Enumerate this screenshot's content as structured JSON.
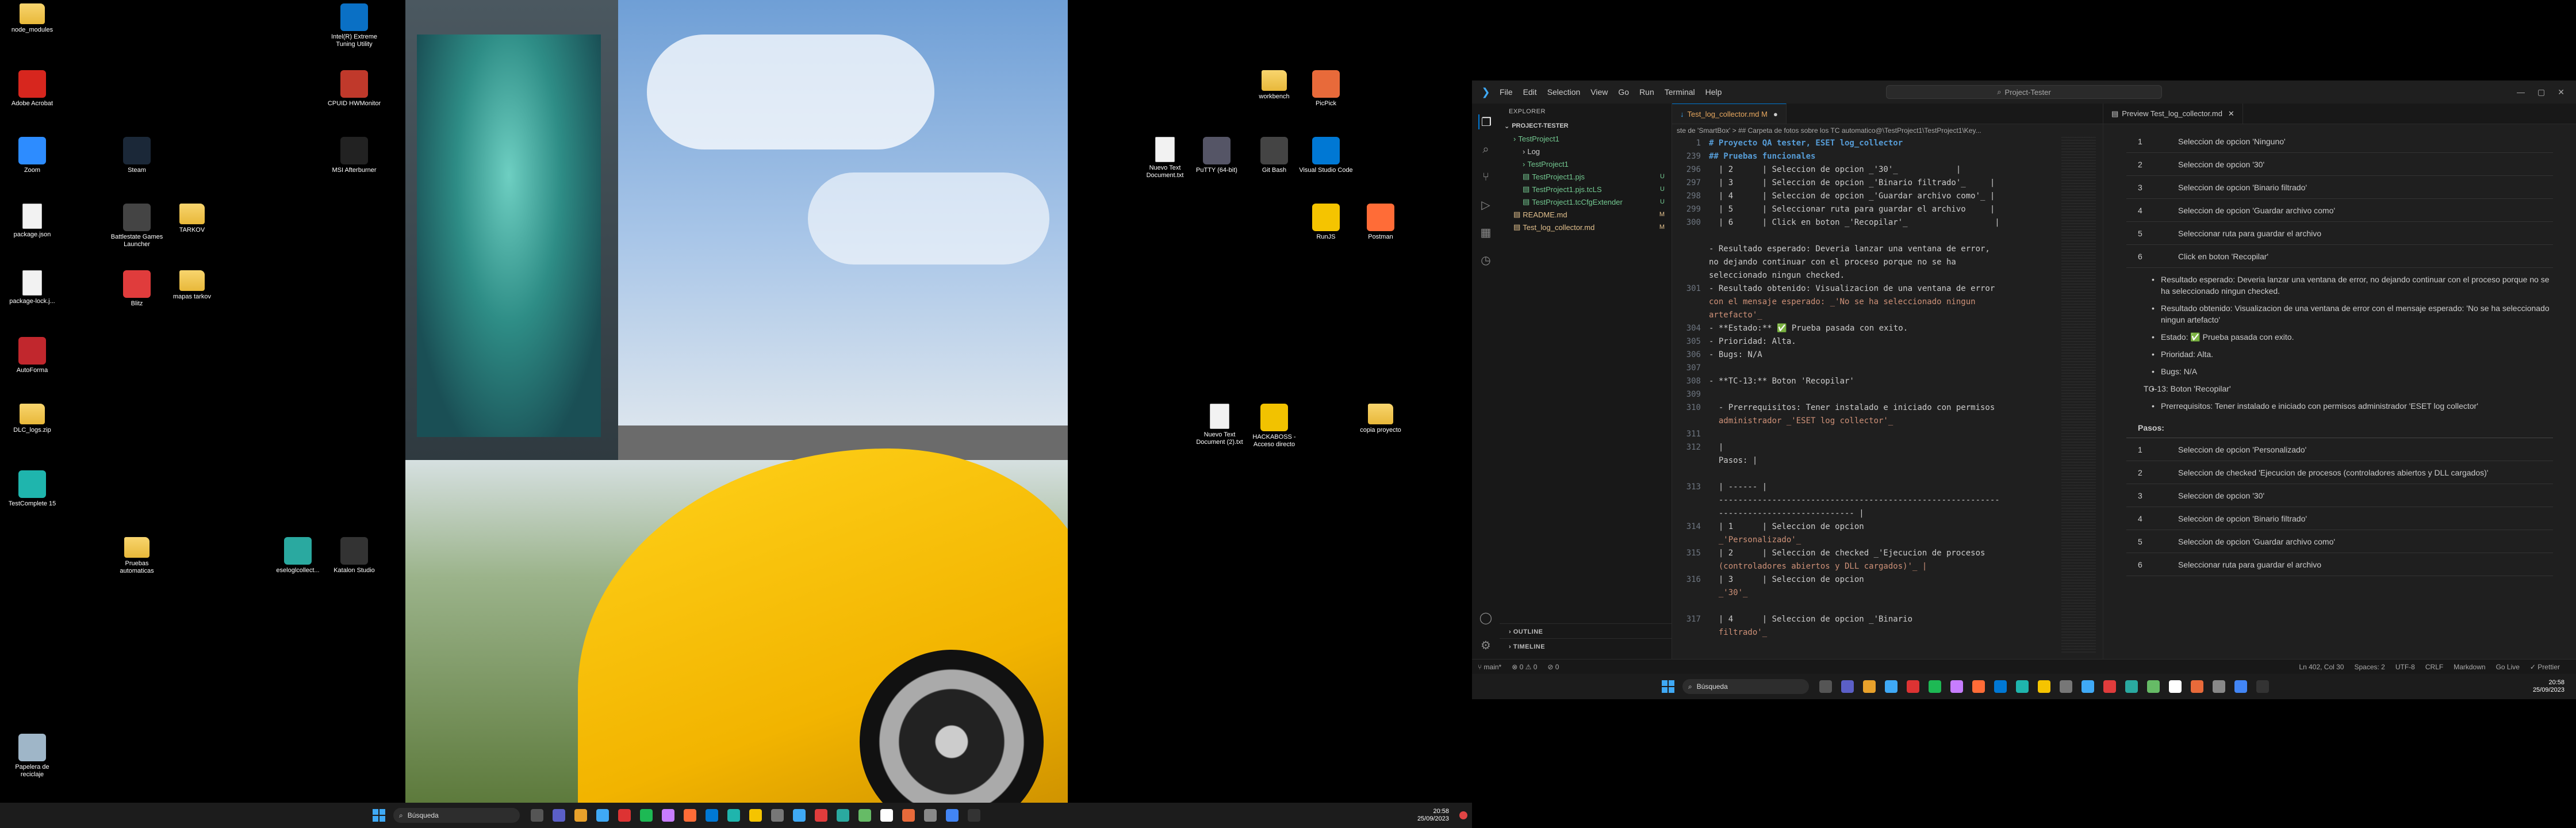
{
  "left_desktop": {
    "icons": [
      {
        "label": "node_modules",
        "icon": "folder-icon"
      },
      {
        "label": "Adobe Acrobat",
        "icon": "acrobat-icon"
      },
      {
        "label": "Zoom",
        "icon": "zoom-icon"
      },
      {
        "label": "package.json",
        "icon": "doc-icon"
      },
      {
        "label": "package-lock.j...",
        "icon": "doc-icon"
      },
      {
        "label": "AutoForma",
        "icon": "autoforma-icon"
      },
      {
        "label": "DLC_logs.zip",
        "icon": "zip-icon"
      },
      {
        "label": "TestComplete 15",
        "icon": "testcomplete-icon"
      },
      {
        "label": "Papelera de reciclaje",
        "icon": "recycle-bin-icon"
      },
      {
        "label": "Steam",
        "icon": "steam-icon"
      },
      {
        "label": "Battlestate Games Launcher",
        "icon": "bsg-icon"
      },
      {
        "label": "Blitz",
        "icon": "blitz-icon"
      },
      {
        "label": "Pruebas automaticas",
        "icon": "folder-icon"
      },
      {
        "label": "TARKOV",
        "icon": "folder-icon"
      },
      {
        "label": "mapas tarkov",
        "icon": "folder-icon"
      },
      {
        "label": "eseloglcollect...",
        "icon": "eset-icon"
      },
      {
        "label": "Intel(R) Extreme Tuning Utility",
        "icon": "intel-icon"
      },
      {
        "label": "CPUID HWMonitor",
        "icon": "hwmonitor-icon"
      },
      {
        "label": "MSI Afterburner",
        "icon": "msi-icon"
      },
      {
        "label": "Katalon Studio",
        "icon": "katalon-icon"
      }
    ],
    "right_icons": [
      {
        "label": "workbench",
        "icon": "folder-icon"
      },
      {
        "label": "PicPick",
        "icon": "picpick-icon"
      },
      {
        "label": "Nuevo Text Document.txt",
        "icon": "doc-icon"
      },
      {
        "label": "PuTTY (64-bit)",
        "icon": "putty-icon"
      },
      {
        "label": "Git Bash",
        "icon": "gitbash-icon"
      },
      {
        "label": "Visual Studio Code",
        "icon": "vscode-icon"
      },
      {
        "label": "RunJS",
        "icon": "runjs-icon"
      },
      {
        "label": "Postman",
        "icon": "postman-icon"
      },
      {
        "label": "Nuevo Text Document (2).txt",
        "icon": "doc-icon"
      },
      {
        "label": "HACKABOSS - Acceso directo",
        "icon": "warning-icon"
      },
      {
        "label": "copia proyecto",
        "icon": "folder-icon"
      }
    ]
  },
  "taskbar_left": {
    "search": "Búsqueda",
    "time": "20:58",
    "date": "25/09/2023"
  },
  "taskbar_right": {
    "search": "Búsqueda",
    "time": "20:58",
    "date": "25/09/2023"
  },
  "vscode": {
    "menu": [
      "File",
      "Edit",
      "Selection",
      "View",
      "Go",
      "Run",
      "Terminal",
      "Help"
    ],
    "command_center": "Project-Tester",
    "explorer_title": "EXPLORER",
    "project_title": "PROJECT-TESTER",
    "tree": [
      {
        "label": "TestProject1",
        "indent": 1,
        "badge": "",
        "color": "#73c991"
      },
      {
        "label": "Log",
        "indent": 2,
        "badge": "",
        "color": "#ccc"
      },
      {
        "label": "TestProject1",
        "indent": 2,
        "badge": "",
        "color": "#73c991"
      },
      {
        "label": "TestProject1.pjs",
        "indent": 2,
        "badge": "U",
        "color": "#73c991"
      },
      {
        "label": "TestProject1.pjs.tcLS",
        "indent": 2,
        "badge": "U",
        "color": "#73c991"
      },
      {
        "label": "TestProject1.tcCfgExtender",
        "indent": 2,
        "badge": "U",
        "color": "#73c991"
      },
      {
        "label": "README.md",
        "indent": 1,
        "badge": "M",
        "color": "#e2c08d"
      },
      {
        "label": "Test_log_collector.md",
        "indent": 1,
        "badge": "M",
        "color": "#e2c08d"
      }
    ],
    "outline": "OUTLINE",
    "timeline": "TIMELINE",
    "editor_tab": "Test_log_collector.md M",
    "preview_tab": "Preview Test_log_collector.md",
    "breadcrumb": "ste de 'SmartBox' > ## Carpeta de fotos sobre los TC automatico@\\TestProject1\\TestProject1\\Key...",
    "code_lines": [
      {
        "n": "1",
        "t": "# Proyecto QA tester, ESET log_collector",
        "c": "h1"
      },
      {
        "n": "239",
        "t": "## Pruebas funcionales",
        "c": "h1"
      },
      {
        "n": "296",
        "t": "  | 2      | Seleccion de opcion _'30'_            |",
        "c": ""
      },
      {
        "n": "297",
        "t": "  | 3      | Seleccion de opcion _'Binario filtrado'_     |",
        "c": ""
      },
      {
        "n": "298",
        "t": "  | 4      | Seleccion de opcion _'Guardar archivo como'_ |",
        "c": ""
      },
      {
        "n": "299",
        "t": "  | 5      | Seleccionar ruta para guardar el archivo     |",
        "c": ""
      },
      {
        "n": "300",
        "t": "  | 6      | Click en boton _'Recopilar'_                  |",
        "c": ""
      },
      {
        "n": "",
        "t": "",
        "c": ""
      },
      {
        "n": "",
        "t": "- Resultado esperado: Deveria lanzar una ventana de error,",
        "c": ""
      },
      {
        "n": "",
        "t": "no dejando continuar con el proceso porque no se ha",
        "c": ""
      },
      {
        "n": "",
        "t": "seleccionado ningun checked.",
        "c": ""
      },
      {
        "n": "301",
        "t": "- Resultado obtenido: Visualizacion de una ventana de error",
        "c": ""
      },
      {
        "n": "",
        "t": "con el mensaje esperado: _'No se ha seleccionado ningun",
        "c": "em"
      },
      {
        "n": "",
        "t": "artefacto'_",
        "c": "em"
      },
      {
        "n": "304",
        "t": "- **Estado:** ✅ Prueba pasada con exito.",
        "c": ""
      },
      {
        "n": "305",
        "t": "- Prioridad: Alta.",
        "c": ""
      },
      {
        "n": "306",
        "t": "- Bugs: N/A",
        "c": ""
      },
      {
        "n": "307",
        "t": "",
        "c": ""
      },
      {
        "n": "308",
        "t": "- **TC-13:** Boton 'Recopilar'",
        "c": ""
      },
      {
        "n": "309",
        "t": "",
        "c": ""
      },
      {
        "n": "310",
        "t": "  - Prerrequisitos: Tener instalado e iniciado con permisos",
        "c": ""
      },
      {
        "n": "",
        "t": "  administrador _'ESET log collector'_",
        "c": "em"
      },
      {
        "n": "311",
        "t": "",
        "c": ""
      },
      {
        "n": "312",
        "t": "  |",
        "c": ""
      },
      {
        "n": "",
        "t": "  Pasos: |",
        "c": ""
      },
      {
        "n": "",
        "t": "",
        "c": ""
      },
      {
        "n": "313",
        "t": "  | ------ |",
        "c": ""
      },
      {
        "n": "",
        "t": "  ----------------------------------------------------------",
        "c": ""
      },
      {
        "n": "",
        "t": "  ---------------------------- |",
        "c": ""
      },
      {
        "n": "314",
        "t": "  | 1      | Seleccion de opcion",
        "c": ""
      },
      {
        "n": "",
        "t": "  _'Personalizado'_",
        "c": "em"
      },
      {
        "n": "315",
        "t": "  | 2      | Seleccion de checked _'Ejecucion de procesos",
        "c": ""
      },
      {
        "n": "",
        "t": "  (controladores abiertos y DLL cargados)'_ |",
        "c": "em"
      },
      {
        "n": "316",
        "t": "  | 3      | Seleccion de opcion",
        "c": ""
      },
      {
        "n": "",
        "t": "  _'30'_",
        "c": "em"
      },
      {
        "n": "",
        "t": "",
        "c": ""
      },
      {
        "n": "317",
        "t": "  | 4      | Seleccion de opcion _'Binario",
        "c": ""
      },
      {
        "n": "",
        "t": "  filtrado'_",
        "c": "em"
      }
    ],
    "preview": {
      "rows_top": [
        {
          "n": "1",
          "t": "Seleccion de opcion 'Ninguno'"
        },
        {
          "n": "2",
          "t": "Seleccion de opcion '30'"
        },
        {
          "n": "3",
          "t": "Seleccion de opcion 'Binario filtrado'"
        },
        {
          "n": "4",
          "t": "Seleccion de opcion 'Guardar archivo como'"
        },
        {
          "n": "5",
          "t": "Seleccionar ruta para guardar el archivo"
        },
        {
          "n": "6",
          "t": "Click en boton 'Recopilar'"
        }
      ],
      "bullets": [
        "Resultado esperado: Deveria lanzar una ventana de error, no dejando continuar con el proceso porque no se ha seleccionado ningun checked.",
        "Resultado obtenido: Visualizacion de una ventana de error con el mensaje esperado: 'No se ha seleccionado ningun artefacto'",
        "Estado: ✅ Prueba pasada con exito.",
        "Prioridad: Alta.",
        "Bugs: N/A"
      ],
      "tc13": "TC-13: Boton 'Recopilar'",
      "prereq": "Prerrequisitos: Tener instalado e iniciado con permisos administrador 'ESET log collector'",
      "pasos_header": "Pasos:",
      "rows_bottom": [
        {
          "n": "1",
          "t": "Seleccion de opcion 'Personalizado'"
        },
        {
          "n": "2",
          "t": "Seleccion de checked 'Ejecucion de procesos (controladores abiertos y DLL cargados)'"
        },
        {
          "n": "3",
          "t": "Seleccion de opcion '30'"
        },
        {
          "n": "4",
          "t": "Seleccion de opcion 'Binario filtrado'"
        },
        {
          "n": "5",
          "t": "Seleccion de opcion 'Guardar archivo como'"
        },
        {
          "n": "6",
          "t": "Seleccionar ruta para guardar el archivo"
        }
      ]
    },
    "status": {
      "branch": "main*",
      "problems": "⊗ 0 ⚠ 0",
      "ports": "⊘ 0",
      "position": "Ln 402, Col 30",
      "spaces": "Spaces: 2",
      "encoding": "UTF-8",
      "eol": "CRLF",
      "language": "Markdown",
      "golive": "Go Live",
      "prettier": "✓ Prettier"
    }
  }
}
